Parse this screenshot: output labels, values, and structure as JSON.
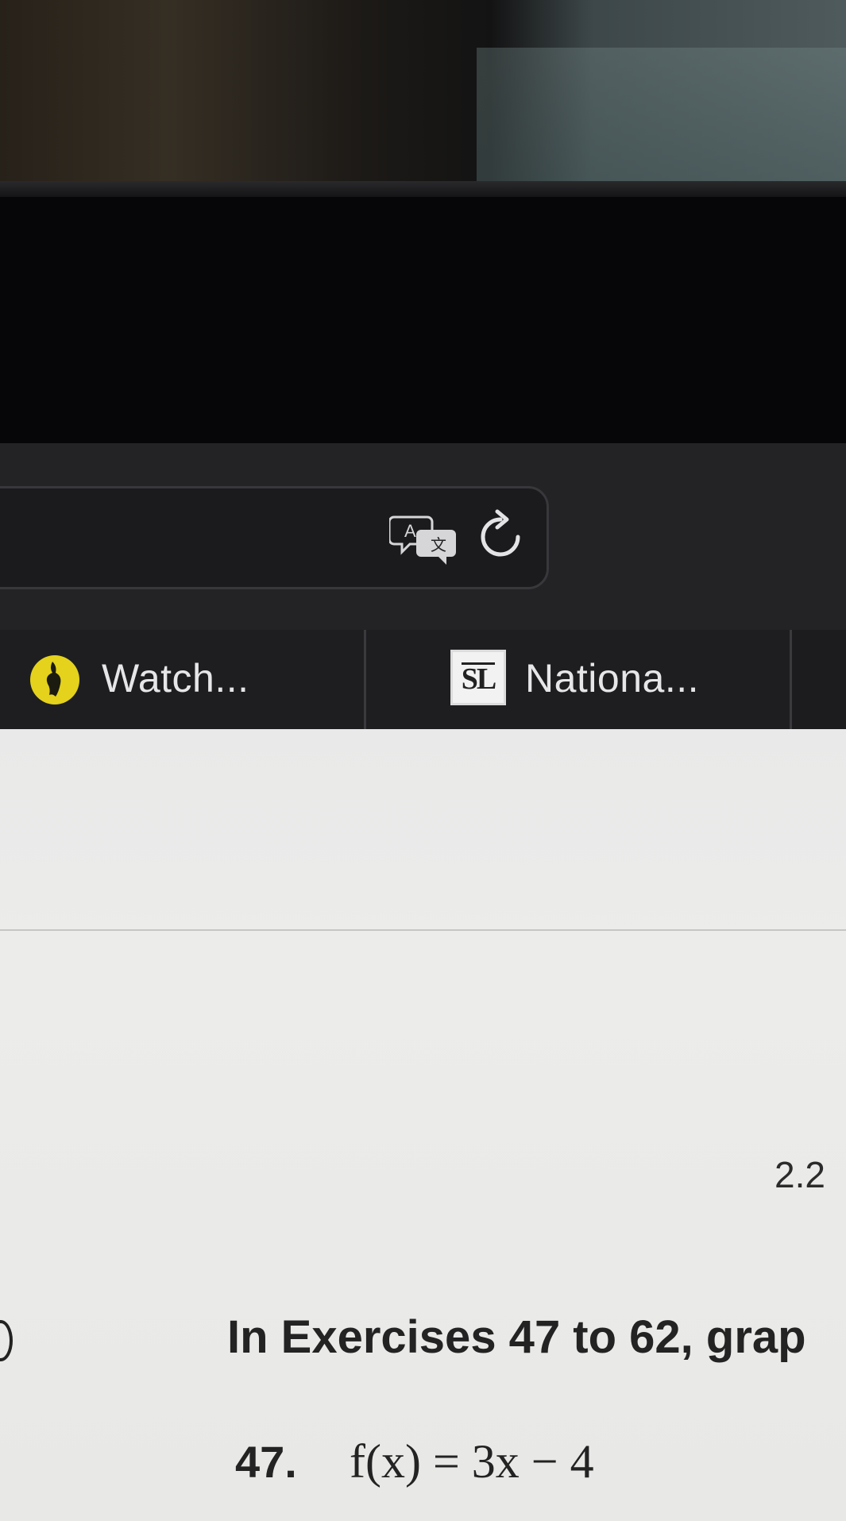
{
  "tabs": [
    {
      "label": "Watch...",
      "icon": "fish-player-icon"
    },
    {
      "label": "Nationa...",
      "icon": "sl-logo",
      "favicon_text": "SL"
    }
  ],
  "toolbar": {
    "translate_icon": "translate-icon",
    "reload_icon": "reload-icon"
  },
  "document": {
    "section": "2.2",
    "instruction": "In Exercises 47 to 62, grap",
    "exercise_number": "47.",
    "exercise_equation": "f(x) = 3x − 4"
  }
}
